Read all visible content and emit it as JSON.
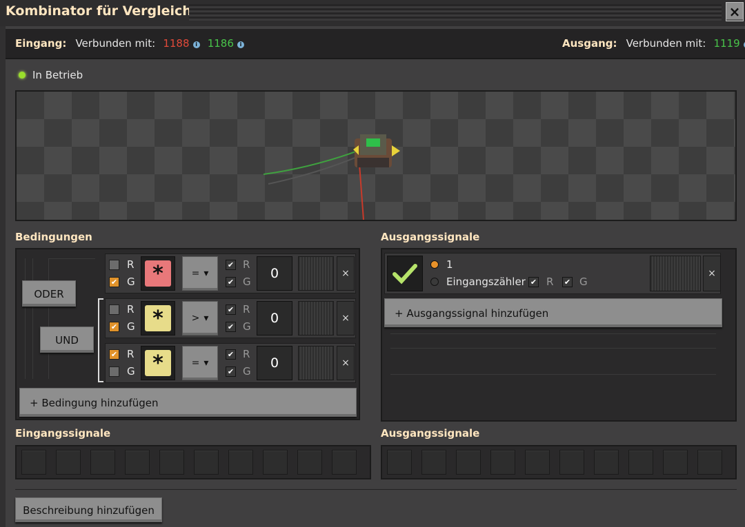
{
  "window": {
    "title": "Kombinator für Vergleiche",
    "close_icon": "×"
  },
  "connections": {
    "input_label": "Eingang:",
    "input_text": "Verbunden mit:",
    "input_red": "1188",
    "input_green": "1186",
    "output_label": "Ausgang:",
    "output_text": "Verbunden mit:",
    "output_green": "1119",
    "info_glyph": "i"
  },
  "status": {
    "text": "In Betrieb",
    "color": "#9adf2c"
  },
  "conditions": {
    "title": "Bedingungen",
    "logic": {
      "or_label": "ODER",
      "and_label": "UND"
    },
    "rows": [
      {
        "left_r": false,
        "left_g": true,
        "signal": "*",
        "signal_color": "red",
        "comparator": "=",
        "right_r": true,
        "right_g": true,
        "value": "0"
      },
      {
        "left_r": false,
        "left_g": true,
        "signal": "*",
        "signal_color": "yellow",
        "comparator": ">",
        "right_r": true,
        "right_g": true,
        "value": "0"
      },
      {
        "left_r": true,
        "left_g": false,
        "signal": "*",
        "signal_color": "yellow",
        "comparator": "=",
        "right_r": true,
        "right_g": true,
        "value": "0"
      }
    ],
    "r_label": "R",
    "g_label": "G",
    "remove": "×",
    "add_label": "+ Bedingung hinzufügen"
  },
  "outputs": {
    "title": "Ausgangssignale",
    "row": {
      "option_one": "1",
      "option_count": "Eingangszähler",
      "r_label": "R",
      "g_label": "G",
      "remove": "×",
      "r_checked": true,
      "g_checked": true
    },
    "add_label": "+ Ausgangssignal hinzufügen"
  },
  "input_signals": {
    "title": "Eingangssignale"
  },
  "output_signals": {
    "title": "Ausgangssignale"
  },
  "description_button": "Beschreibung hinzufügen"
}
